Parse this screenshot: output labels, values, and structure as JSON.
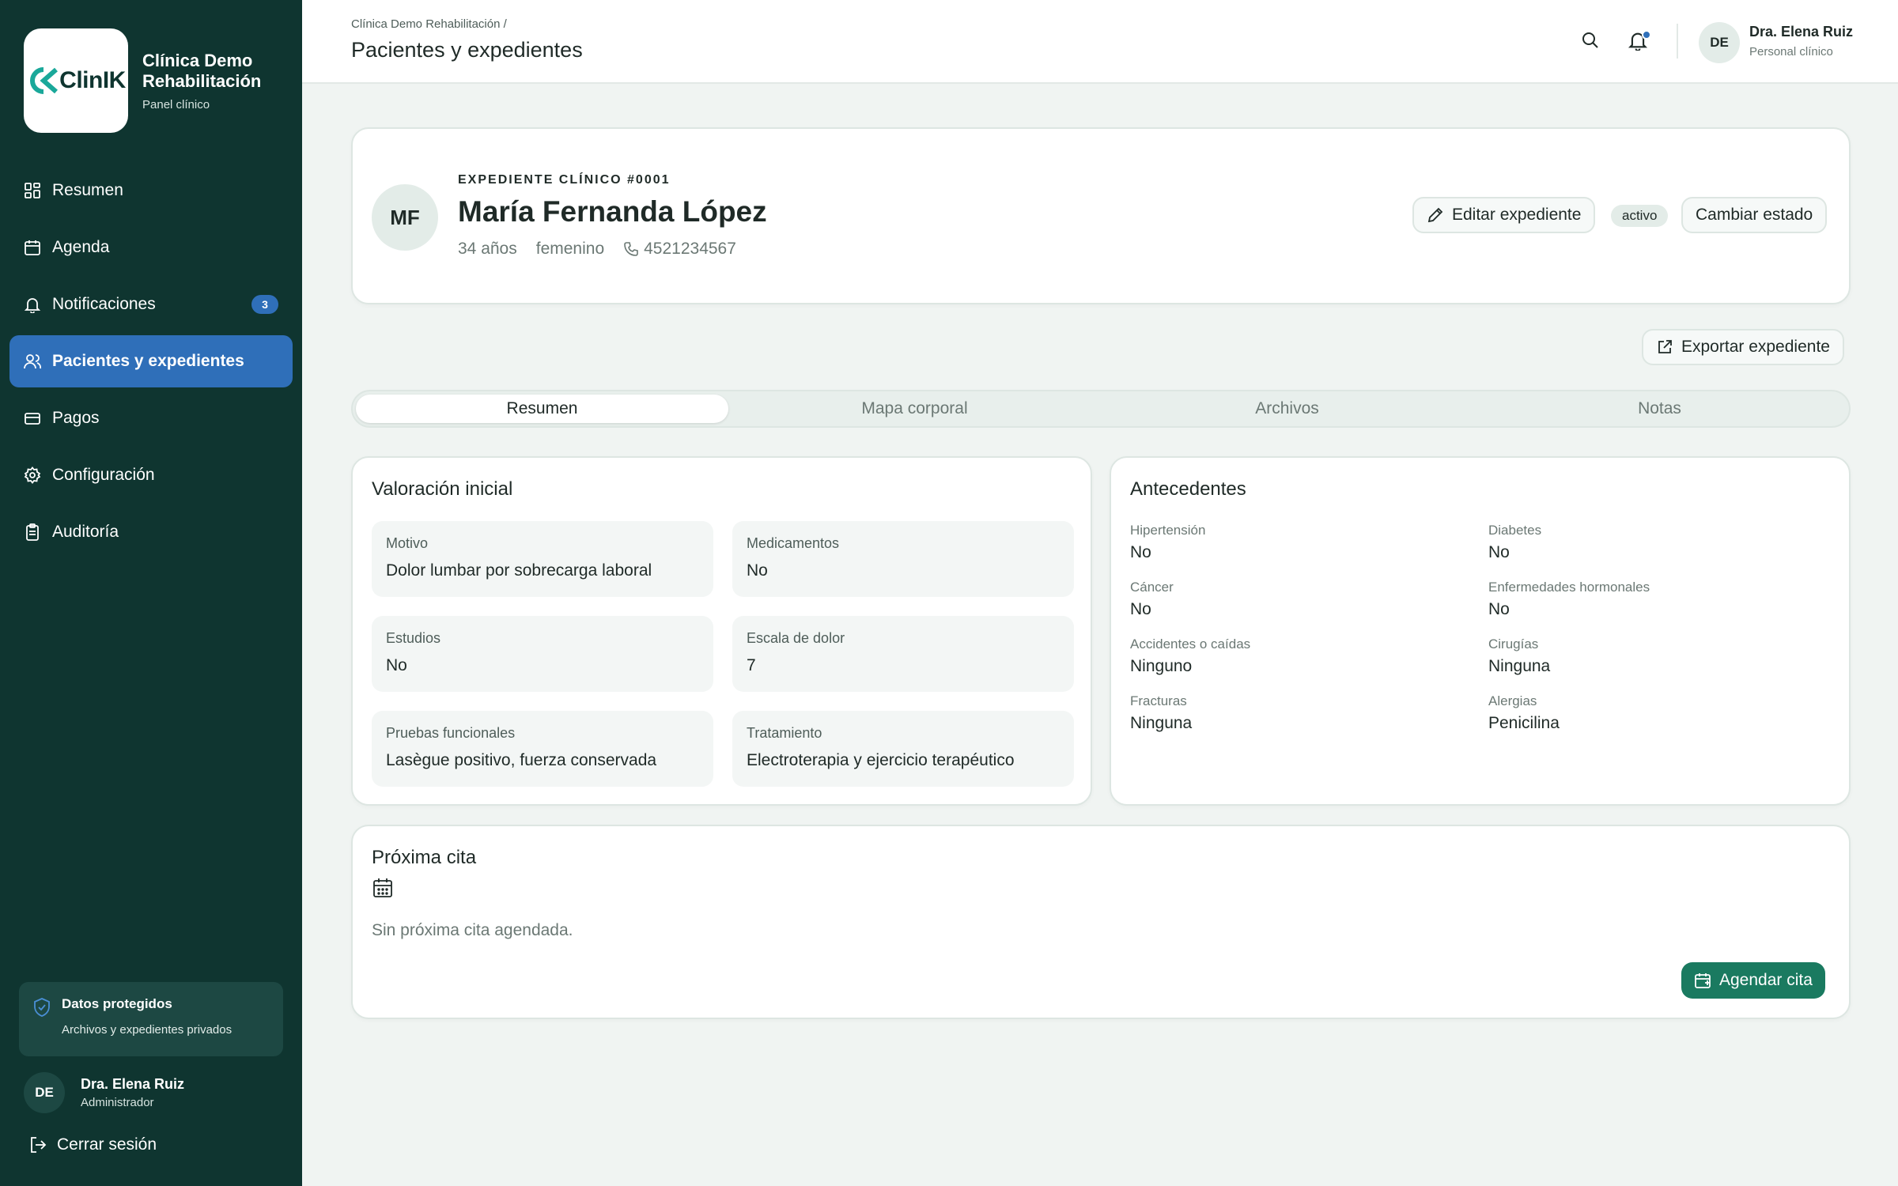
{
  "sidebar": {
    "logo_text": "ClinIK",
    "clinic_name": "Clínica Demo Rehabilitación",
    "panel_label": "Panel clínico",
    "items": [
      {
        "label": "Resumen",
        "icon": "grid-icon"
      },
      {
        "label": "Agenda",
        "icon": "calendar-icon"
      },
      {
        "label": "Notificaciones",
        "icon": "bell-icon",
        "badge": "3"
      },
      {
        "label": "Pacientes y expedientes",
        "icon": "users-icon",
        "active": true
      },
      {
        "label": "Pagos",
        "icon": "card-icon"
      },
      {
        "label": "Configuración",
        "icon": "gear-icon"
      },
      {
        "label": "Auditoría",
        "icon": "clipboard-icon"
      }
    ],
    "protected": {
      "title": "Datos protegidos",
      "subtitle": "Archivos y expedientes privados"
    },
    "user": {
      "initials": "DE",
      "name": "Dra. Elena Ruiz",
      "role": "Administrador"
    },
    "logout_label": "Cerrar sesión"
  },
  "header": {
    "breadcrumb": "Clínica Demo Rehabilitación /",
    "title": "Pacientes y expedientes",
    "user": {
      "initials": "DE",
      "name": "Dra. Elena Ruiz",
      "role": "Personal clínico"
    }
  },
  "patient": {
    "initials": "MF",
    "record_label": "EXPEDIENTE CLÍNICO #0001",
    "name": "María Fernanda López",
    "age": "34 años",
    "gender": "femenino",
    "phone": "4521234567",
    "edit_label": "Editar expediente",
    "status": "activo",
    "change_state_label": "Cambiar estado"
  },
  "export_label": "Exportar expediente",
  "tabs": [
    {
      "label": "Resumen",
      "active": true
    },
    {
      "label": "Mapa corporal"
    },
    {
      "label": "Archivos"
    },
    {
      "label": "Notas"
    }
  ],
  "valoracion": {
    "title": "Valoración inicial",
    "fields": [
      {
        "label": "Motivo",
        "value": "Dolor lumbar por sobrecarga laboral"
      },
      {
        "label": "Medicamentos",
        "value": "No"
      },
      {
        "label": "Estudios",
        "value": "No"
      },
      {
        "label": "Escala de dolor",
        "value": "7"
      },
      {
        "label": "Pruebas funcionales",
        "value": "Lasègue positivo, fuerza conservada"
      },
      {
        "label": "Tratamiento",
        "value": "Electroterapia y ejercicio terapéutico"
      }
    ]
  },
  "antecedentes": {
    "title": "Antecedentes",
    "fields": [
      {
        "label": "Hipertensión",
        "value": "No"
      },
      {
        "label": "Diabetes",
        "value": "No"
      },
      {
        "label": "Cáncer",
        "value": "No"
      },
      {
        "label": "Enfermedades hormonales",
        "value": "No"
      },
      {
        "label": "Accidentes o caídas",
        "value": "Ninguno"
      },
      {
        "label": "Cirugías",
        "value": "Ninguna"
      },
      {
        "label": "Fracturas",
        "value": "Ninguna"
      },
      {
        "label": "Alergias",
        "value": "Penicilina"
      }
    ]
  },
  "cita": {
    "title": "Próxima cita",
    "empty_text": "Sin próxima cita agendada.",
    "button_label": "Agendar cita"
  },
  "colors": {
    "sidebar": "#0f3530",
    "active_nav": "#2f6fb9",
    "primary_button": "#1a7a60",
    "background": "#f0f4f2"
  }
}
